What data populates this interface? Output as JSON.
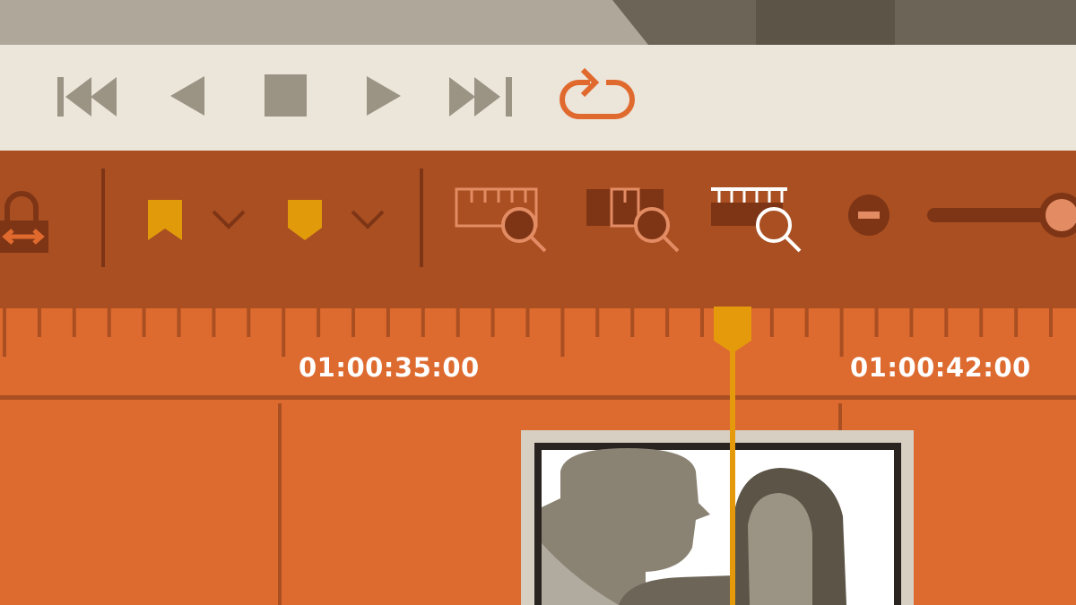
{
  "colors": {
    "topbar_light": "#aea79a",
    "topbar_dark": "#6b6457",
    "topbar_darker": "#5b5447",
    "transport_bg": "#ece5da",
    "transport_icon": "#9b9383",
    "loop_accent": "#e06a2e",
    "toolbar_bg": "#a94f22",
    "toolbar_dark": "#7e3515",
    "marker_yellow": "#e19b0a",
    "timeline_orange": "#dd6a2f",
    "playhead": "#e59a0c",
    "zoom_active": "#ffffff",
    "slider_knob": "#e38c63"
  },
  "transport": {
    "icons": [
      "go-to-start-icon",
      "step-back-icon",
      "stop-icon",
      "play-icon",
      "go-to-end-icon",
      "loop-icon"
    ],
    "loop_active": true
  },
  "toolbar": {
    "icons": [
      "lock-clip-icon",
      "marker-icon",
      "marker-dropdown-icon",
      "in-marker-icon",
      "in-marker-dropdown-icon",
      "zoom-to-fit-icon",
      "zoom-to-selection-icon",
      "zoom-ruler-icon",
      "zoom-out-icon",
      "zoom-slider"
    ],
    "zoom_slider_level": 1.0
  },
  "timeline": {
    "timecodes": [
      "01:00:35:00",
      "01:00:42:00"
    ],
    "clip_thumbnail": "video-clip-thumbnail-icon"
  }
}
